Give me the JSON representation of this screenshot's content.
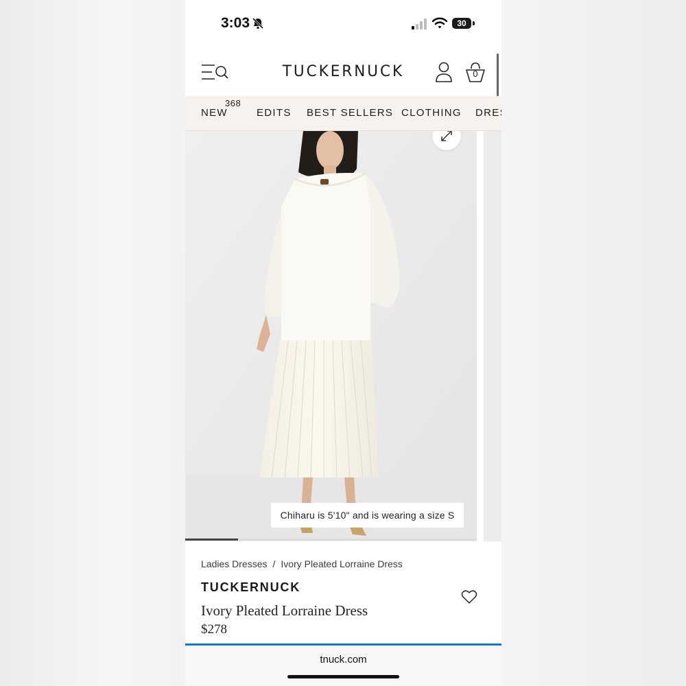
{
  "status_bar": {
    "time": "3:03",
    "battery": "30"
  },
  "header": {
    "logo": "TUCKERNUCK",
    "bag_count": "0"
  },
  "nav": {
    "items": [
      {
        "label": "NEW",
        "badge": "368"
      },
      {
        "label": "EDITS"
      },
      {
        "label": "BEST SELLERS"
      },
      {
        "label": "CLOTHING"
      },
      {
        "label": "DRESSES"
      }
    ]
  },
  "gallery": {
    "caption": "Chiharu is 5'10\" and is wearing a size S",
    "progress_fraction": 0.18
  },
  "product": {
    "breadcrumb": [
      "Ladies Dresses",
      "/",
      "Ivory Pleated Lorraine Dress"
    ],
    "brand": "TUCKERNUCK",
    "name": "Ivory Pleated Lorraine Dress",
    "price": "$278"
  },
  "browser": {
    "url": "tnuck.com"
  },
  "colors": {
    "accent_blue": "#1a73d9",
    "nav_bg": "#f6f3ee"
  }
}
